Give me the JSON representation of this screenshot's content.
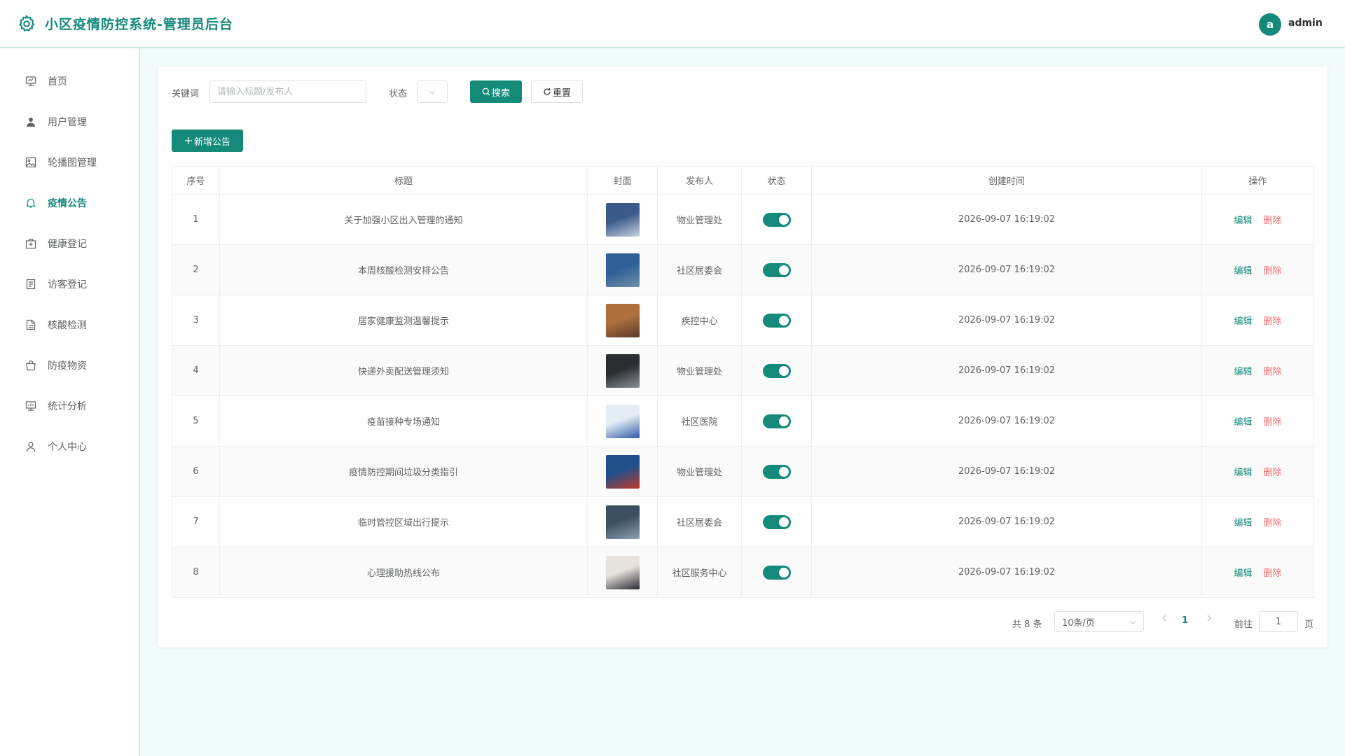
{
  "app": {
    "title": "小区疫情防控系统-管理员后台",
    "avatar_letter": "a",
    "username": "admin",
    "accent": "#138a7a"
  },
  "sidebar": {
    "items": [
      {
        "label": "首页",
        "icon": "dashboard-icon",
        "active": false
      },
      {
        "label": "用户管理",
        "icon": "user-icon",
        "active": false
      },
      {
        "label": "轮播图管理",
        "icon": "image-icon",
        "active": false
      },
      {
        "label": "疫情公告",
        "icon": "bell-icon",
        "active": true
      },
      {
        "label": "健康登记",
        "icon": "medical-kit-icon",
        "active": false
      },
      {
        "label": "访客登记",
        "icon": "document-list-icon",
        "active": false
      },
      {
        "label": "核酸检测",
        "icon": "document-icon",
        "active": false
      },
      {
        "label": "防疫物资",
        "icon": "shopping-bag-icon",
        "active": false
      },
      {
        "label": "统计分析",
        "icon": "chart-icon",
        "active": false
      },
      {
        "label": "个人中心",
        "icon": "person-icon",
        "active": false
      }
    ]
  },
  "filters": {
    "keyword_label": "关键词",
    "keyword_placeholder": "请输入标题/发布人",
    "keyword_value": "",
    "status_label": "状态",
    "search_label": "搜索",
    "reset_label": "重置"
  },
  "toolbar": {
    "add_label": "新增公告"
  },
  "table": {
    "headers": [
      "序号",
      "标题",
      "封面",
      "发布人",
      "状态",
      "创建时间",
      "操作"
    ],
    "edit_label": "编辑",
    "delete_label": "删除",
    "rows": [
      {
        "index": "1",
        "title": "关于加强小区出入管理的通知",
        "publisher": "物业管理处",
        "status": true,
        "created": "2026-09-07 16:19:02",
        "cover": "cover-entrance-checkpoint",
        "cover_colors": [
          "#3b5a8c",
          "#c9d2de"
        ]
      },
      {
        "index": "2",
        "title": "本周核酸检测安排公告",
        "publisher": "社区居委会",
        "status": true,
        "created": "2026-09-07 16:19:02",
        "cover": "cover-testing-queue",
        "cover_colors": [
          "#2f5f99",
          "#6e8fa8"
        ]
      },
      {
        "index": "3",
        "title": "居家健康监测温馨提示",
        "publisher": "疾控中心",
        "status": true,
        "created": "2026-09-07 16:19:02",
        "cover": "cover-home-temperature",
        "cover_colors": [
          "#b0703e",
          "#5a3a2c"
        ]
      },
      {
        "index": "4",
        "title": "快递外卖配送管理须知",
        "publisher": "物业管理处",
        "status": true,
        "created": "2026-09-07 16:19:02",
        "cover": "cover-delivery-shelf",
        "cover_colors": [
          "#2b2d33",
          "#8a9099"
        ]
      },
      {
        "index": "5",
        "title": "疫苗接种专场通知",
        "publisher": "社区医院",
        "status": true,
        "created": "2026-09-07 16:19:02",
        "cover": "cover-vaccination",
        "cover_colors": [
          "#e6eef5",
          "#2e5aa8"
        ]
      },
      {
        "index": "6",
        "title": "疫情防控期间垃圾分类指引",
        "publisher": "物业管理处",
        "status": true,
        "created": "2026-09-07 16:19:02",
        "cover": "cover-waste-bins",
        "cover_colors": [
          "#1f4f8a",
          "#c0392b"
        ]
      },
      {
        "index": "7",
        "title": "临时管控区域出行提示",
        "publisher": "社区居委会",
        "status": true,
        "created": "2026-09-07 16:19:02",
        "cover": "cover-control-area",
        "cover_colors": [
          "#3d4f63",
          "#8fa1b3"
        ]
      },
      {
        "index": "8",
        "title": "心理援助热线公布",
        "publisher": "社区服务中心",
        "status": true,
        "created": "2026-09-07 16:19:02",
        "cover": "cover-hotline",
        "cover_colors": [
          "#e8e3dc",
          "#2a2a35"
        ]
      }
    ]
  },
  "pagination": {
    "total_text": "共 8 条",
    "page_size": "10条/页",
    "current_page": "1",
    "goto_label": "前往",
    "goto_value": "1",
    "page_suffix": "页"
  }
}
